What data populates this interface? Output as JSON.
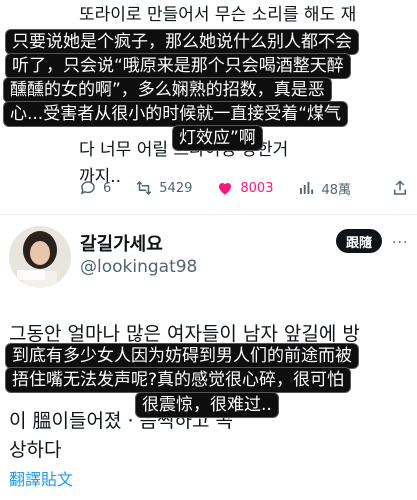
{
  "tweet1": {
    "lines": [
      "또라이로 만들어서 무슨 소리를 해도 재",
      "",
      "",
      "",
      "",
      "다 너무 어릴      드라이빙 당한거",
      "까지.."
    ],
    "actions": {
      "replies": "6",
      "retweets": "5429",
      "likes": "8003",
      "views": "48萬"
    }
  },
  "subtitles1": [
    "只要说她是个疯子，那么她说什么别人都不会",
    "听了，只会说“哦原来是那个只会喝酒整天醉",
    "醺醺的女的啊”，多么娴熟的招数，真是恶",
    "心...受害者从很小的时候就一直接受着“煤气",
    "灯效应”啊"
  ],
  "tweet2": {
    "name": "갈길가세요",
    "handle": "@lookingat98",
    "follow_label": "跟隨",
    "more": "···",
    "lines": [
      "그동안 얼마나 많은 여자들이 남자 앞길에 방",
      "",
      "",
      "이 膃이들어졌     ·     음찍하고 곡",
      "상하다"
    ],
    "translate_label": "翻譯貼文"
  },
  "subtitles2": [
    "到底有多少女人因为妨碍到男人们的前途而被",
    "捂住嘴无法发声呢?真的感觉很心碎，很可怕",
    "很震惊，很难过.."
  ],
  "colors": {
    "like": "#f91880",
    "link": "#1d9bf0",
    "muted": "#536471"
  }
}
